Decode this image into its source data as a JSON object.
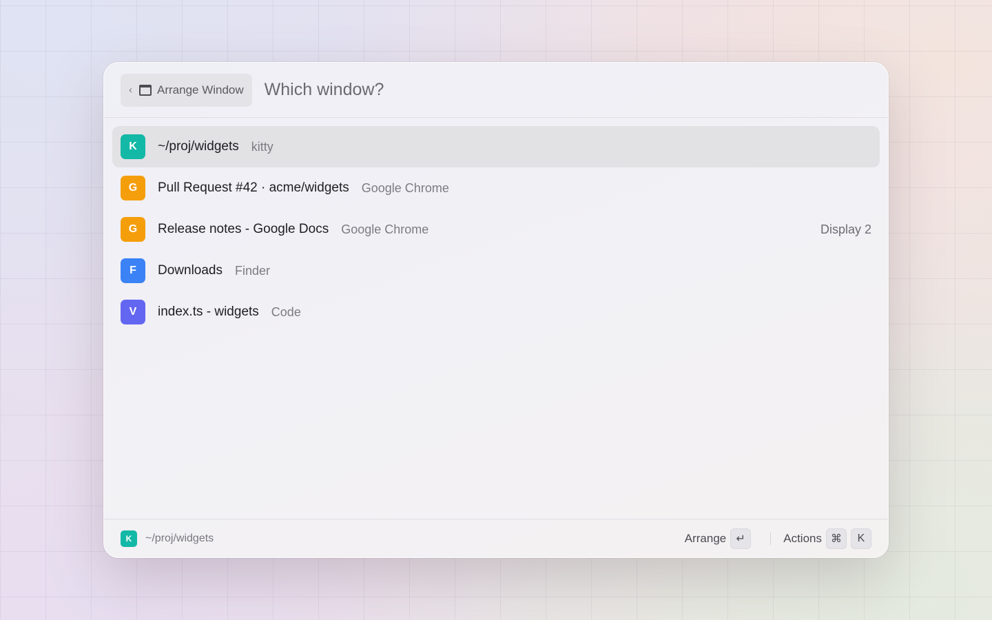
{
  "header": {
    "back_label": "Arrange Window",
    "back_chevron": "‹",
    "back_icon": "window-icon",
    "query_placeholder": "Which window?"
  },
  "windows": [
    {
      "icon_letter": "K",
      "icon_color": "#14b8a6",
      "title": "~/proj/widgets",
      "app": "kitty",
      "accessory": "",
      "selected": true
    },
    {
      "icon_letter": "G",
      "icon_color": "#f59e0b",
      "title": "Pull Request #42 · acme/widgets",
      "app": "Google Chrome",
      "accessory": "",
      "selected": false
    },
    {
      "icon_letter": "G",
      "icon_color": "#f59e0b",
      "title": "Release notes - Google Docs",
      "app": "Google Chrome",
      "accessory": "Display 2",
      "selected": false
    },
    {
      "icon_letter": "F",
      "icon_color": "#3b82f6",
      "title": "Downloads",
      "app": "Finder",
      "accessory": "",
      "selected": false
    },
    {
      "icon_letter": "V",
      "icon_color": "#6366f1",
      "title": "index.ts - widgets",
      "app": "Code",
      "accessory": "",
      "selected": false
    }
  ],
  "footer": {
    "icon_letter": "K",
    "icon_color": "#14b8a6",
    "path": "~/proj/widgets",
    "primary_action": "Arrange",
    "primary_key": "↵",
    "actions_label": "Actions",
    "actions_keys": [
      "⌘",
      "K"
    ]
  }
}
